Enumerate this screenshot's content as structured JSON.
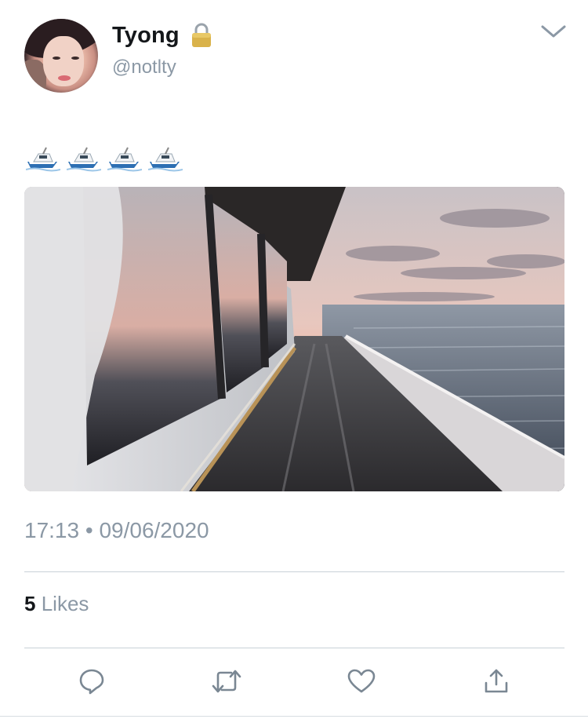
{
  "author": {
    "display_name": "Tyong",
    "username": "@notlty",
    "protected_icon": "lock-icon"
  },
  "tweet": {
    "emoji": [
      "speedboat",
      "speedboat",
      "speedboat",
      "speedboat"
    ],
    "media_description_icon": "photo",
    "time": "17:13",
    "separator": "•",
    "date": "09/06/2020"
  },
  "stats": {
    "likes_count": "5",
    "likes_label": "Likes"
  },
  "actions": [
    "reply-icon",
    "retweet-icon",
    "like-icon",
    "share-icon"
  ],
  "colors": {
    "text": "#14171a",
    "secondary": "#8b98a5",
    "icon": "#7a8793",
    "divider": "#c9d1d8"
  }
}
